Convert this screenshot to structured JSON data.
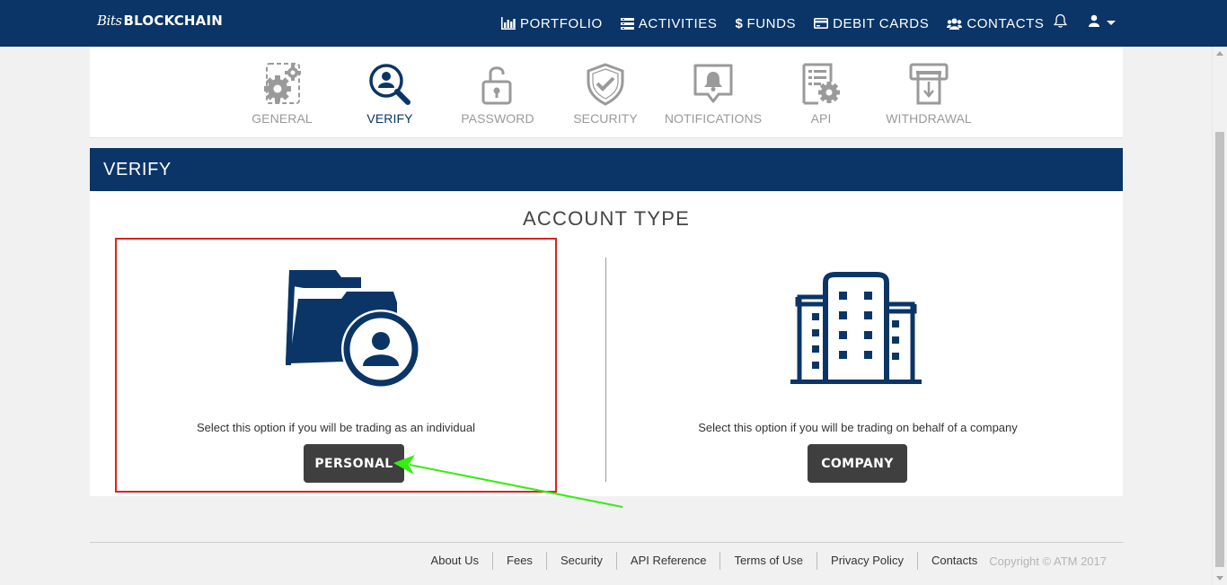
{
  "brand": {
    "script": "Bits",
    "main": "BLOCKCHAIN"
  },
  "nav": {
    "items": [
      {
        "label": "PORTFOLIO",
        "icon": "bar-chart-icon"
      },
      {
        "label": "ACTIVITIES",
        "icon": "list-icon"
      },
      {
        "label": "FUNDS",
        "icon": "dollar-icon"
      },
      {
        "label": "DEBIT CARDS",
        "icon": "credit-card-icon"
      },
      {
        "label": "CONTACTS",
        "icon": "users-icon"
      }
    ],
    "notifications_icon": "bell-icon",
    "user_icon": "user-icon"
  },
  "settings_tabs": [
    {
      "label": "GENERAL",
      "icon": "gears-icon",
      "active": false
    },
    {
      "label": "VERIFY",
      "icon": "verify-search-user-icon",
      "active": true
    },
    {
      "label": "PASSWORD",
      "icon": "padlock-icon",
      "active": false
    },
    {
      "label": "SECURITY",
      "icon": "shield-check-icon",
      "active": false
    },
    {
      "label": "NOTIFICATIONS",
      "icon": "bell-bubble-icon",
      "active": false
    },
    {
      "label": "API",
      "icon": "document-gear-icon",
      "active": false
    },
    {
      "label": "WITHDRAWAL",
      "icon": "atm-withdraw-icon",
      "active": false
    }
  ],
  "verify": {
    "header": "VERIFY",
    "account_type_title": "ACCOUNT TYPE",
    "personal": {
      "icon": "folder-user-icon",
      "description": "Select this option if you will be trading as an individual",
      "button": "PERSONAL"
    },
    "company": {
      "icon": "office-building-icon",
      "description": "Select this option if you will be trading on behalf of a company",
      "button": "COMPANY"
    }
  },
  "footer": {
    "links": [
      "About Us",
      "Fees",
      "Security",
      "API Reference",
      "Terms of Use",
      "Privacy Policy",
      "Contacts"
    ],
    "copyright": "Copyright © ATM 2017"
  },
  "colors": {
    "navy": "#0a3566",
    "button_dark": "#3f3f3f",
    "tab_inactive": "#9a9a9a",
    "highlight_red": "#e02020",
    "arrow_green": "#33ee11"
  }
}
